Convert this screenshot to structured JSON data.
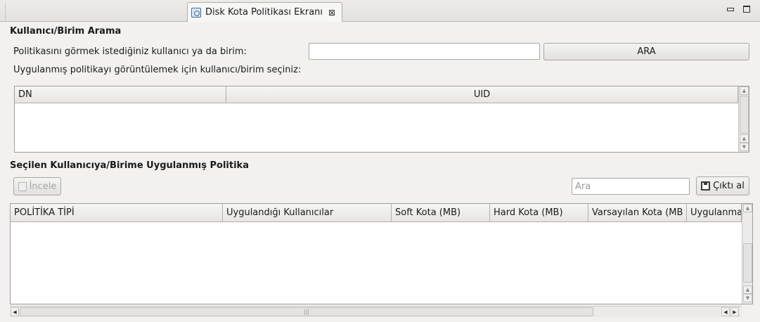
{
  "tab": {
    "title": "Disk Kota Politikası Ekranı",
    "icon": "policy-page-icon",
    "close_glyph": "⊠"
  },
  "search_section": {
    "title": "Kullanıcı/Birim Arama",
    "prompt_label": "Politikasını görmek istediğiniz kullanıcı ya da birim:",
    "input_value": "",
    "search_button_label": "ARA",
    "select_hint": "Uygulanmış politikayı görüntülemek için kullanıcı/birim seçiniz:"
  },
  "user_table": {
    "columns": [
      "DN",
      "UID"
    ],
    "rows": []
  },
  "policy_section": {
    "title": "Seçilen Kullanıcıya/Birime Uygulanmış Politika",
    "inspect_button_label": "İncele",
    "search_placeholder": "Ara",
    "export_button_label": "Çıktı al"
  },
  "policy_table": {
    "columns": [
      "POLİTİKA TİPİ",
      "Uygulandığı Kullanıcılar",
      "Soft Kota (MB)",
      "Hard Kota  (MB)",
      "Varsayılan Kota (MB",
      "Uygulanma"
    ],
    "rows": []
  },
  "colors": {
    "window_bg": "#f2f1f0",
    "table_bg": "#ffffff",
    "disabled_text": "#a8a8a8"
  }
}
